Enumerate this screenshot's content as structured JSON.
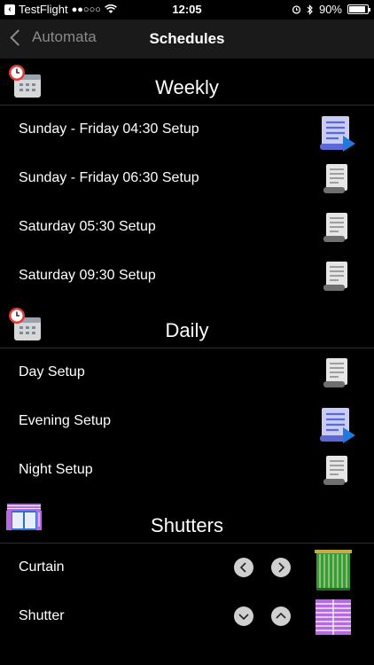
{
  "status": {
    "carrier": "TestFlight",
    "signal": "●●○○○",
    "time": "12:05",
    "battery": "90%",
    "battery_level": 0.9
  },
  "nav": {
    "back": "Automata",
    "title": "Schedules"
  },
  "sections": {
    "weekly": {
      "title": "Weekly",
      "items": [
        "Sunday - Friday 04:30 Setup",
        "Sunday - Friday 06:30 Setup",
        "Saturday 05:30 Setup",
        "Saturday 09:30 Setup"
      ]
    },
    "daily": {
      "title": "Daily",
      "items": [
        "Day Setup",
        "Evening Setup",
        "Night Setup"
      ]
    },
    "shutters": {
      "title": "Shutters",
      "items": [
        "Curtain",
        "Shutter"
      ]
    }
  },
  "icons": {
    "schedule": "calendar-clock-icon",
    "document": "document-icon",
    "active": "document-play-icon"
  },
  "colors": {
    "accent": "#3b6fd9",
    "doc_blue": "#5a69d6",
    "curtain_green": "#3a9a3a",
    "shutter_purple": "#b56be0"
  }
}
